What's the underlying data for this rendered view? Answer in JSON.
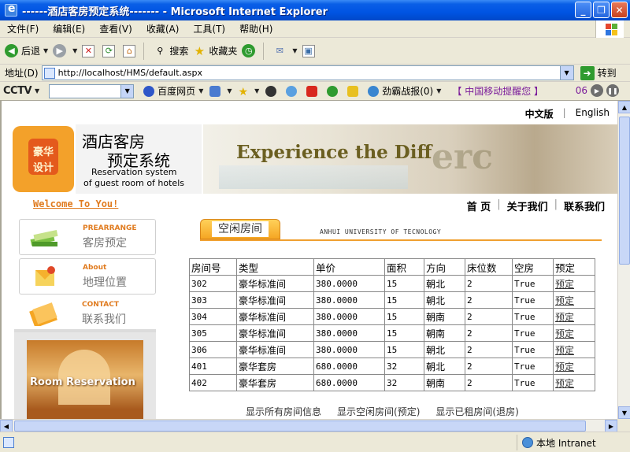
{
  "window": {
    "title": "------酒店客房预定系统------- - Microsoft Internet Explorer",
    "min": "_",
    "max": "❐",
    "close": "✕"
  },
  "menu": [
    "文件(F)",
    "编辑(E)",
    "查看(V)",
    "收藏(A)",
    "工具(T)",
    "帮助(H)"
  ],
  "toolbar": {
    "back": "后退",
    "search": "搜索",
    "favorites": "收藏夹"
  },
  "address": {
    "label": "地址(D)",
    "url": "http://localhost/HMS/default.aspx",
    "go": "转到"
  },
  "cctv": {
    "logo": "CCTV",
    "baidu": "百度网页",
    "game": "劲霸战报(0)",
    "promo": "【 中国移动提醒您 】",
    "num": "06"
  },
  "page": {
    "lang_cn": "中文版",
    "lang_sep": "|",
    "lang_en": "English",
    "logo_t1": "豪华",
    "logo_t2": "设计",
    "banner_cn1": "酒店客房",
    "banner_cn2": "预定系统",
    "banner_en1": "Reservation system",
    "banner_en2": "of guest room of hotels",
    "banner_slogan": "Experience the Diff",
    "banner_ghost": "erc",
    "welcome": "Welcome To You!",
    "nav": [
      "首 页",
      "关于我们",
      "联系我们"
    ],
    "left": [
      {
        "en": "PREARRANGE",
        "cn": "客房预定"
      },
      {
        "en": "About",
        "cn": "地理位置"
      },
      {
        "en": "CONTACT",
        "cn": "联系我们"
      }
    ],
    "room_banner": "Room Reservation",
    "tab_title": "空闲房间",
    "university": "ANHUI UNIVERSITY OF TECNOLOGY",
    "bottom_links": [
      "显示所有房间信息",
      "显示空闲房间(预定)",
      "显示已租房间(退房)"
    ]
  },
  "table": {
    "headers": [
      "房间号",
      "类型",
      "单价",
      "面积",
      "方向",
      "床位数",
      "空房",
      "预定"
    ],
    "rows": [
      [
        "302",
        "豪华标准间",
        "380.0000",
        "15",
        "朝北",
        "2",
        "True",
        "预定"
      ],
      [
        "303",
        "豪华标准间",
        "380.0000",
        "15",
        "朝北",
        "2",
        "True",
        "预定"
      ],
      [
        "304",
        "豪华标准间",
        "380.0000",
        "15",
        "朝南",
        "2",
        "True",
        "预定"
      ],
      [
        "305",
        "豪华标准间",
        "380.0000",
        "15",
        "朝南",
        "2",
        "True",
        "预定"
      ],
      [
        "306",
        "豪华标准间",
        "380.0000",
        "15",
        "朝北",
        "2",
        "True",
        "预定"
      ],
      [
        "401",
        "豪华套房",
        "680.0000",
        "32",
        "朝北",
        "2",
        "True",
        "预定"
      ],
      [
        "402",
        "豪华套房",
        "680.0000",
        "32",
        "朝南",
        "2",
        "True",
        "预定"
      ]
    ]
  },
  "status": {
    "zone": "本地 Intranet"
  }
}
